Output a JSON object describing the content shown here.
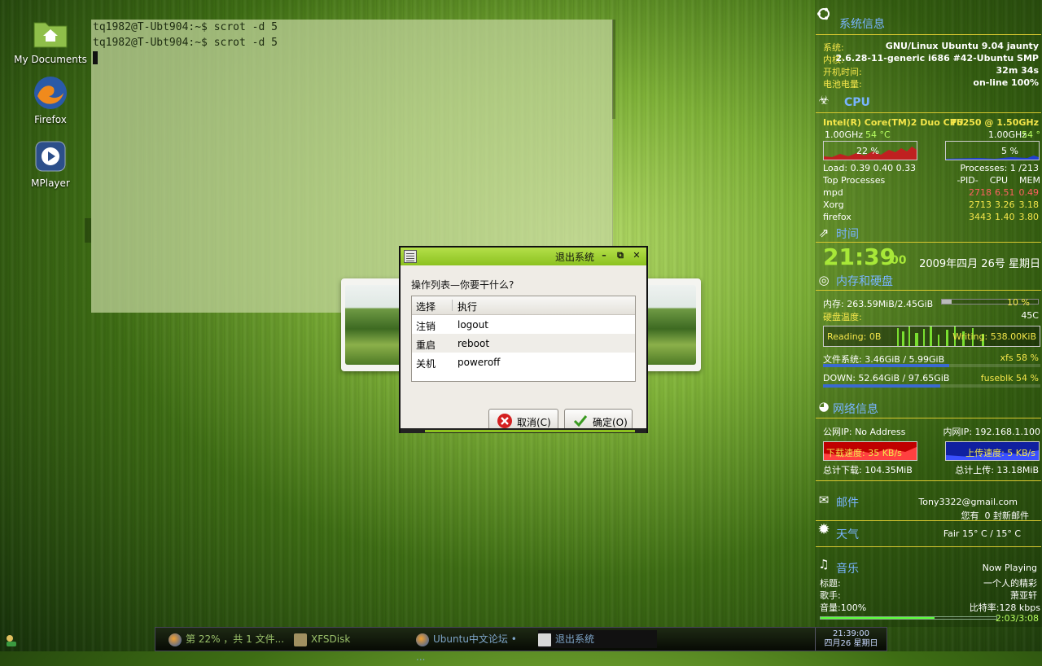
{
  "desktop": {
    "icons": [
      {
        "label": "My Documents",
        "icon": "home-folder-icon"
      },
      {
        "label": "Firefox",
        "icon": "firefox-icon"
      },
      {
        "label": "MPlayer",
        "icon": "mplayer-icon"
      }
    ]
  },
  "terminal": {
    "lines": [
      "tq1982@T-Ubt904:~$ scrot -d 5",
      "tq1982@T-Ubt904:~$ scrot -d 5"
    ]
  },
  "dialog": {
    "title": "退出系统",
    "minimize": "–",
    "restore": "⧉",
    "close": "✕",
    "prompt": "操作列表—你要干什么?",
    "columns": [
      "选择",
      "执行"
    ],
    "rows": [
      {
        "choice": "注销",
        "action": "logout"
      },
      {
        "choice": "重启",
        "action": "reboot"
      },
      {
        "choice": "关机",
        "action": "poweroff"
      }
    ],
    "cancel_label": "取消(C)",
    "ok_label": "确定(O)",
    "colors": {
      "titlebar": "#8cc21f",
      "cancel_icon": "#d42020",
      "ok_icon": "#3a9a20"
    }
  },
  "conky": {
    "system": {
      "title": "系统信息",
      "os_label": "系统:",
      "os_value": "GNU/Linux Ubuntu 9.04 jaunty",
      "kernel_label": "内核:",
      "kernel_value": "2.6.28-11-generic i686 #42-Ubuntu SMP",
      "uptime_label": "开机时间:",
      "uptime_value": "32m 34s",
      "battery_label": "电池电量:",
      "battery_value": "on-line 100%"
    },
    "cpu": {
      "title": "CPU",
      "model": "Intel(R) Core(TM)2 Duo CPU",
      "model_freq": "T5250  @ 1.50GHz",
      "core1_freq": "1.00GHz",
      "core1_temp": "54 °C",
      "core1_pct": "22 %",
      "core2_freq": "1.00GHz",
      "core2_temp": "54 °C",
      "core2_pct": "5 %",
      "load": "Load:  0.39 0.40 0.33",
      "processes": "Processes: 1 /213",
      "top_label": "Top Processes",
      "top_cols": "-PID-    CPU    MEM",
      "procs": [
        {
          "name": "mpd",
          "pid": "2718",
          "cpu": "6.51",
          "mem": "0.49"
        },
        {
          "name": "Xorg",
          "pid": "2713",
          "cpu": "3.26",
          "mem": "3.18"
        },
        {
          "name": "firefox",
          "pid": "3443",
          "cpu": "1.40",
          "mem": "3.80"
        }
      ]
    },
    "time": {
      "title": "时间",
      "clock": "21:39",
      "seconds": "00",
      "date": "2009年四月 26号 星期日"
    },
    "memory": {
      "title": "内存和硬盘",
      "mem": "内存: 263.59MiB/2.45GiB",
      "mem_pct": "10 %",
      "mem_fraction": 0.1,
      "disk_temp_label": "硬盘温度:",
      "disk_temp": "45C",
      "reading": "Reading: 0B",
      "writing": "Writing: 538.00KiB",
      "fs1": "文件系统: 3.46GiB  / 5.99GiB",
      "fs1_type": "xfs 58 %",
      "fs1_fraction": 0.58,
      "fs2": "DOWN:  52.64GiB / 97.65GiB",
      "fs2_type": "fuseblk 54 %",
      "fs2_fraction": 0.54
    },
    "network": {
      "title": "网络信息",
      "public_ip": "公网IP: No Address",
      "local_ip": "内网IP: 192.168.1.100",
      "down_speed": "下载速度: 35  KB/s",
      "up_speed": "上传速度: 5  KB/s",
      "total_down": "总计下载: 104.35MiB",
      "total_up": "总计上传:  13.18MiB"
    },
    "mail": {
      "title": "邮件",
      "address": "Tony3322@gmail.com",
      "count": "您有  0 封新邮件"
    },
    "weather": {
      "title": "天气",
      "value": "Fair 15° C / 15° C"
    },
    "music": {
      "title": "音乐",
      "status": "Now Playing",
      "title_label": "标题:",
      "title_value": "一个人的精彩",
      "artist_label": "歌手:",
      "artist_value": "萧亚轩",
      "volume": "音量:100%",
      "bitrate": "比特率:128 kbps",
      "progress": "2:03/3:08",
      "progress_fraction": 0.65
    }
  },
  "taskbar": {
    "tasks": [
      {
        "label": "第 22% ，共 1 文件...",
        "icon": "firefox-icon"
      },
      {
        "label": "XFSDisk",
        "icon": "folder-icon"
      },
      {
        "label": "Ubuntu中文论坛 • ...",
        "icon": "firefox-icon"
      },
      {
        "label": "退出系统",
        "icon": "dialog-icon"
      }
    ],
    "clock_time": "21:39:00",
    "clock_date": "四月26 星期日"
  }
}
